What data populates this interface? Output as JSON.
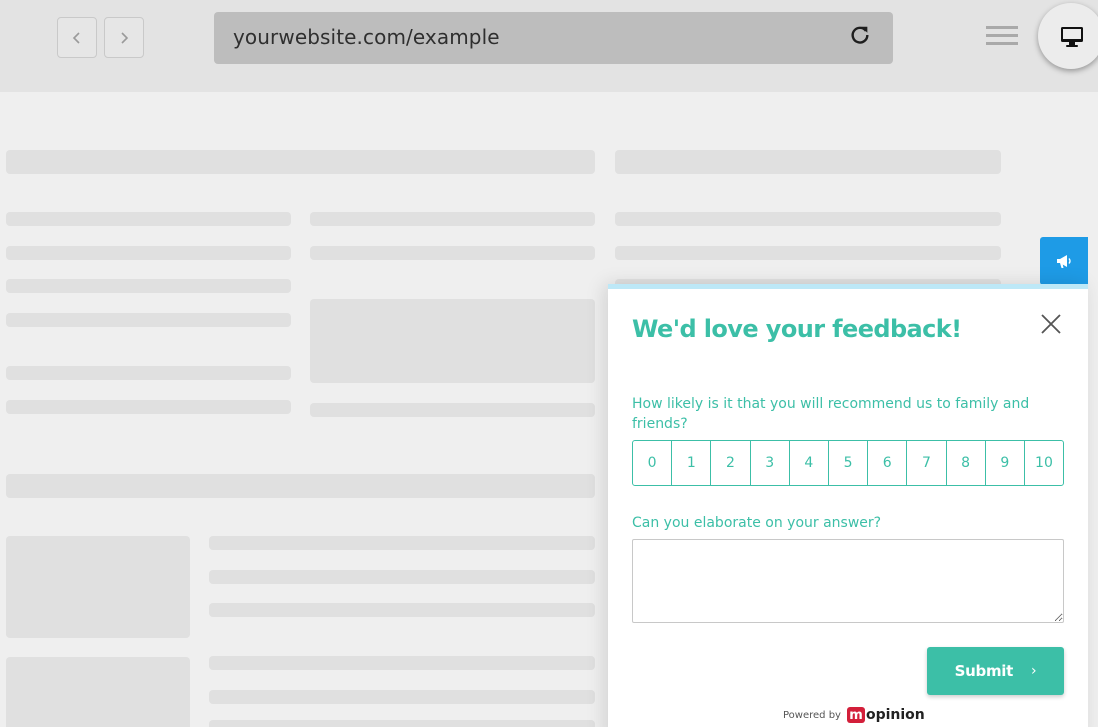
{
  "browser": {
    "url": "yourwebsite.com/example",
    "back_icon": "chevron-left-icon",
    "forward_icon": "chevron-right-icon",
    "reload_icon": "reload-icon",
    "menu_icon": "hamburger-menu-icon",
    "device_icon": "desktop-monitor-icon"
  },
  "feedback_tab": {
    "icon": "megaphone-icon",
    "color": "#1e9be6"
  },
  "modal": {
    "title": "We'd love your feedback!",
    "question1": "How likely is it that you will recommend us to family and friends?",
    "scale": [
      "0",
      "1",
      "2",
      "3",
      "4",
      "5",
      "6",
      "7",
      "8",
      "9",
      "10"
    ],
    "question2": "Can you elaborate on your answer?",
    "textarea_value": "",
    "submit_label": "Submit",
    "submit_chevron": "›",
    "powered_by": "Powered by",
    "logo_letter": "m",
    "logo_text": "opinion",
    "accent_color": "#3cbfa7"
  }
}
